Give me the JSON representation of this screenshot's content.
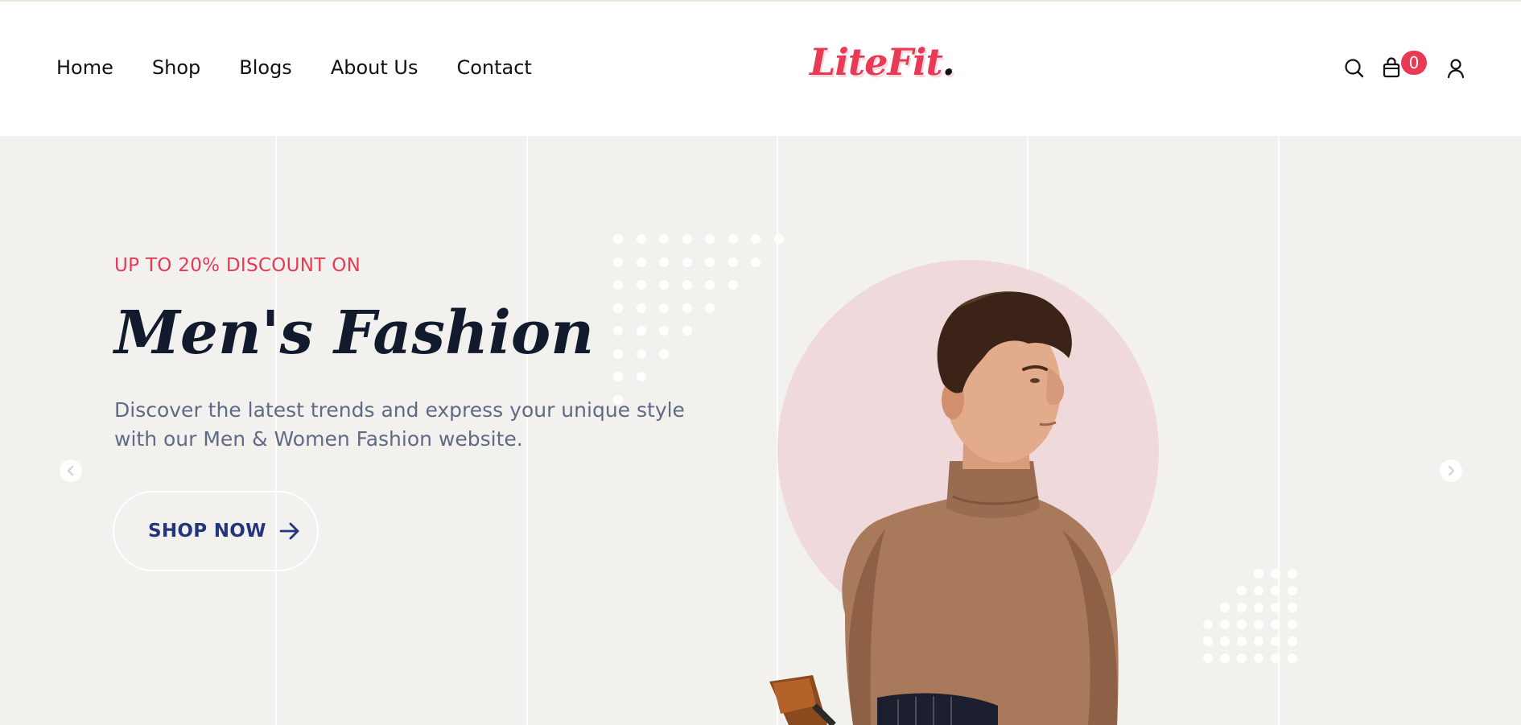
{
  "header": {
    "nav": [
      "Home",
      "Shop",
      "Blogs",
      "About Us",
      "Contact"
    ],
    "logo_text": "LiteFit",
    "logo_dot": ".",
    "cart_count": "0",
    "icons": [
      "search-icon",
      "cart-bag-icon",
      "user-icon"
    ]
  },
  "hero": {
    "eyebrow": "UP TO 20% DISCOUNT ON",
    "title": "Men's Fashion",
    "description_line1": "Discover the latest trends and express your unique style",
    "description_line2": "with our Men & Women Fashion website.",
    "cta_label": "SHOP NOW",
    "prev_icon": "chevron-left-icon",
    "next_icon": "chevron-right-icon"
  },
  "colors": {
    "accent": "#e83a54",
    "title": "#121a2e",
    "text": "#5f6b86",
    "cta": "#23357c",
    "hero_bg": "#f3f1ee",
    "circle": "#efd9da"
  }
}
